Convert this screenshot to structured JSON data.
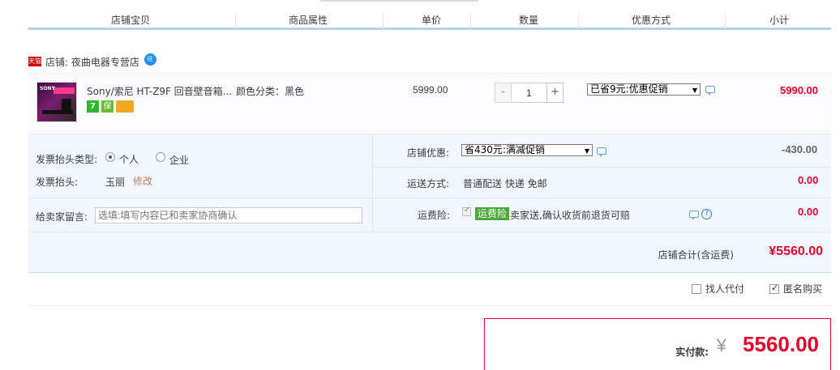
{
  "columns": {
    "shop_item": "店铺宝贝",
    "attributes": "商品属性",
    "unit_price": "单价",
    "quantity": "数量",
    "discount": "优惠方式",
    "subtotal": "小计"
  },
  "shop": {
    "tmall_badge": "天猫",
    "name": "店铺: 夜曲电器专营店",
    "ww_icon": "wangwang-chat-icon"
  },
  "item": {
    "title": "Sony/索尼 HT-Z9F 回音壁音箱...",
    "attribute": "颜色分类：黑色",
    "price": "5999.00",
    "quantity": "1",
    "qty_minus": "-",
    "qty_plus": "+",
    "promo_select": "已省9元:优惠促销",
    "subtotal": "5990.00",
    "badges": [
      "7",
      "保",
      "card"
    ]
  },
  "invoice": {
    "type_label": "发票抬头类型:",
    "option_personal": "个人",
    "option_company": "企业",
    "selected": "个人",
    "title_label": "发票抬头:",
    "title_value": "玉丽",
    "edit_link": "修改"
  },
  "message": {
    "label": "给卖家留言:",
    "placeholder": "选填:填写内容已和卖家协商确认"
  },
  "shop_discount": {
    "label": "店铺优惠:",
    "select": "省430元:满减促销",
    "amount": "-430.00"
  },
  "shipping": {
    "label": "运送方式:",
    "value": "普通配送 快递 免邮",
    "amount": "0.00"
  },
  "insurance": {
    "label": "运费险:",
    "tag": "运费险",
    "text": "卖家送,确认收货前退货可赔",
    "amount": "0.00",
    "checked": true
  },
  "shop_total": {
    "label": "店铺合计(含运费)",
    "amount": "¥5560.00"
  },
  "options": {
    "proxy_pay": "找人代付",
    "proxy_checked": false,
    "anonymous": "匿名购买",
    "anonymous_checked": true
  },
  "payment": {
    "label": "实付款:",
    "currency": "¥",
    "amount": "5560.00"
  }
}
